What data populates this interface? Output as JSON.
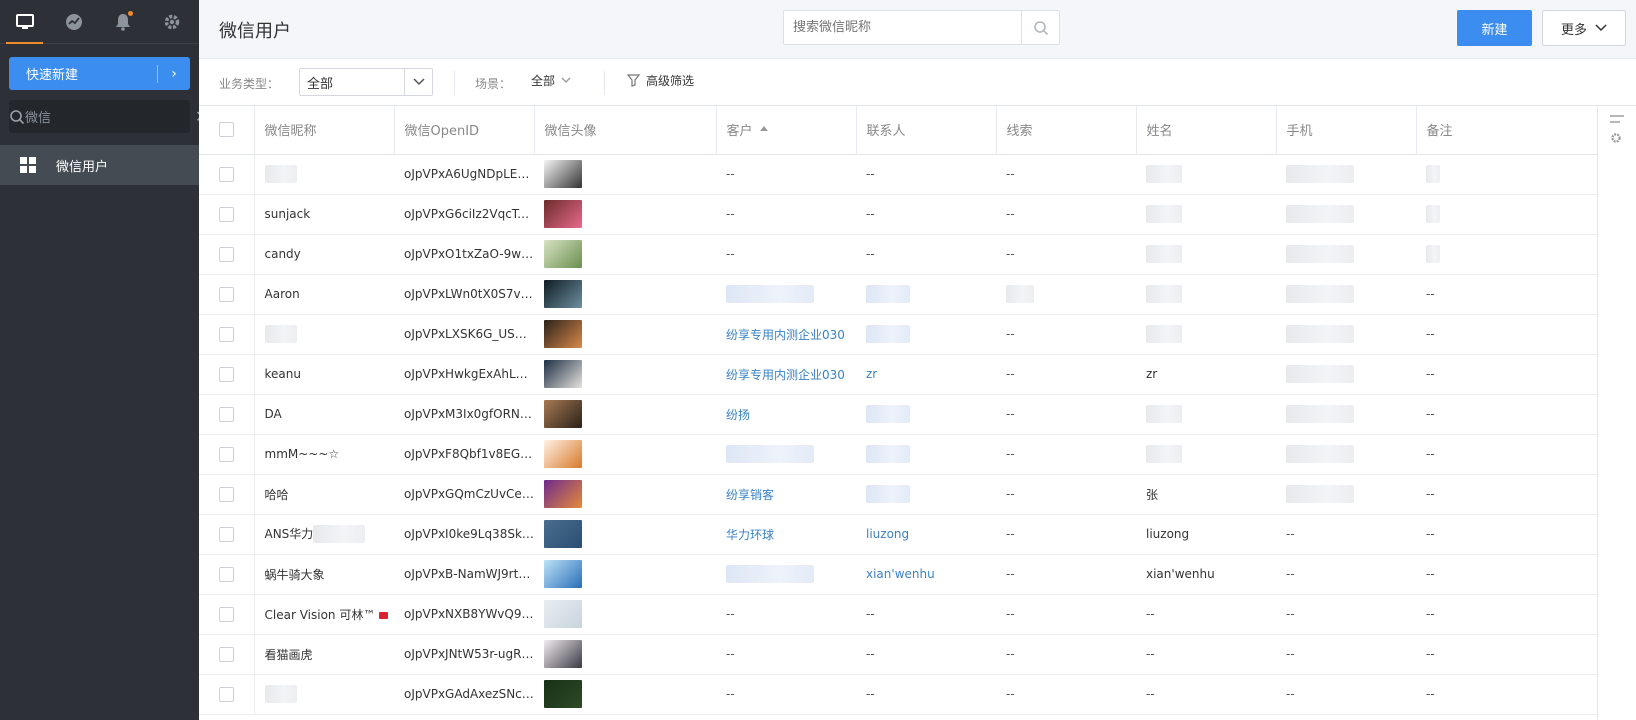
{
  "sidebar": {
    "tabs": [
      {
        "icon": "desktop-icon",
        "active": true
      },
      {
        "icon": "analytics-icon",
        "active": false
      },
      {
        "icon": "bell-icon",
        "active": false
      },
      {
        "icon": "gear-icon",
        "active": false
      }
    ],
    "quick_new_label": "快速新建",
    "search_value": "微信",
    "nav_item_label": "微信用户"
  },
  "header": {
    "title": "微信用户",
    "search_placeholder": "搜索微信昵称",
    "new_button": "新建",
    "more_button": "更多"
  },
  "filters": {
    "biz_type_label": "业务类型：",
    "biz_type_value": "全部",
    "scene_label": "场景：",
    "scene_value": "全部",
    "advanced_label": "高级筛选"
  },
  "table": {
    "columns": [
      "微信昵称",
      "微信OpenID",
      "微信头像",
      "客户",
      "联系人",
      "线索",
      "姓名",
      "手机",
      "备注"
    ],
    "rows": [
      {
        "nickname": "",
        "openid": "oJpVPxA6UgNDpLE7G...",
        "customer": "--",
        "contact": "--",
        "clue": "--",
        "name": "",
        "phone": "",
        "note": ""
      },
      {
        "nickname": "sunjack",
        "openid": "oJpVPxG6ciIz2VqcTcT...",
        "customer": "--",
        "contact": "--",
        "clue": "--",
        "name": "",
        "phone": "",
        "note": ""
      },
      {
        "nickname": "candy",
        "openid": "oJpVPxO1txZaO-9wA...",
        "customer": "--",
        "contact": "--",
        "clue": "--",
        "name": "",
        "phone": "",
        "note": ""
      },
      {
        "nickname": "Aaron",
        "openid": "oJpVPxLWn0tX0S7vC...",
        "customer": "",
        "contact": "",
        "clue": "",
        "name": "",
        "phone": "",
        "note": "--"
      },
      {
        "nickname": "",
        "openid": "oJpVPxLXSK6G_USV-...",
        "customer": "纷享专用内测企业030",
        "contact": "",
        "clue": "--",
        "name": "",
        "phone": "",
        "note": "--"
      },
      {
        "nickname": "keanu",
        "openid": "oJpVPxHwkgExAhLHq...",
        "customer": "纷享专用内测企业030",
        "contact": "zr",
        "clue": "--",
        "name": "zr",
        "phone": "",
        "note": "--"
      },
      {
        "nickname": "DA",
        "openid": "oJpVPxM3Ix0gfORNh...",
        "customer": "纷扬",
        "contact": "",
        "clue": "--",
        "name": "",
        "phone": "",
        "note": "--"
      },
      {
        "nickname": "mmM~~~☆",
        "openid": "oJpVPxF8Qbf1v8EGZ...",
        "customer": "",
        "contact": "",
        "clue": "--",
        "name": "",
        "phone": "",
        "note": "--"
      },
      {
        "nickname": "哈哈",
        "openid": "oJpVPxGQmCzUvCejR...",
        "customer": "纷享销客",
        "contact": "",
        "clue": "--",
        "name": "张",
        "phone": "",
        "note": "--"
      },
      {
        "nickname": "ANS华力",
        "openid": "oJpVPxI0ke9Lq38Skq...",
        "customer": "华力环球",
        "contact": "liuzong",
        "clue": "--",
        "name": "liuzong",
        "phone": "--",
        "note": "--"
      },
      {
        "nickname": "蜗牛骑大象",
        "openid": "oJpVPxB-NamWJ9rtn...",
        "customer": "",
        "contact": "xian'wenhu",
        "clue": "--",
        "name": "xian'wenhu",
        "phone": "--",
        "note": "--"
      },
      {
        "nickname": "Clear Vision 可林™",
        "openid": "oJpVPxNXB8YWvQ9o...",
        "customer": "--",
        "contact": "--",
        "clue": "--",
        "name": "--",
        "phone": "--",
        "note": "--"
      },
      {
        "nickname": "看猫画虎",
        "openid": "oJpVPxJNtW53r-ugRP...",
        "customer": "--",
        "contact": "--",
        "clue": "--",
        "name": "--",
        "phone": "--",
        "note": "--"
      },
      {
        "nickname": "",
        "openid": "oJpVPxGAdAxezSNc-h...",
        "customer": "--",
        "contact": "--",
        "clue": "--",
        "name": "--",
        "phone": "--",
        "note": "--"
      }
    ]
  },
  "colors": {
    "accent": "#3b8df0",
    "sidebar_bg": "#2d3137",
    "link": "#3b82c4",
    "notification": "#f08c2c"
  }
}
